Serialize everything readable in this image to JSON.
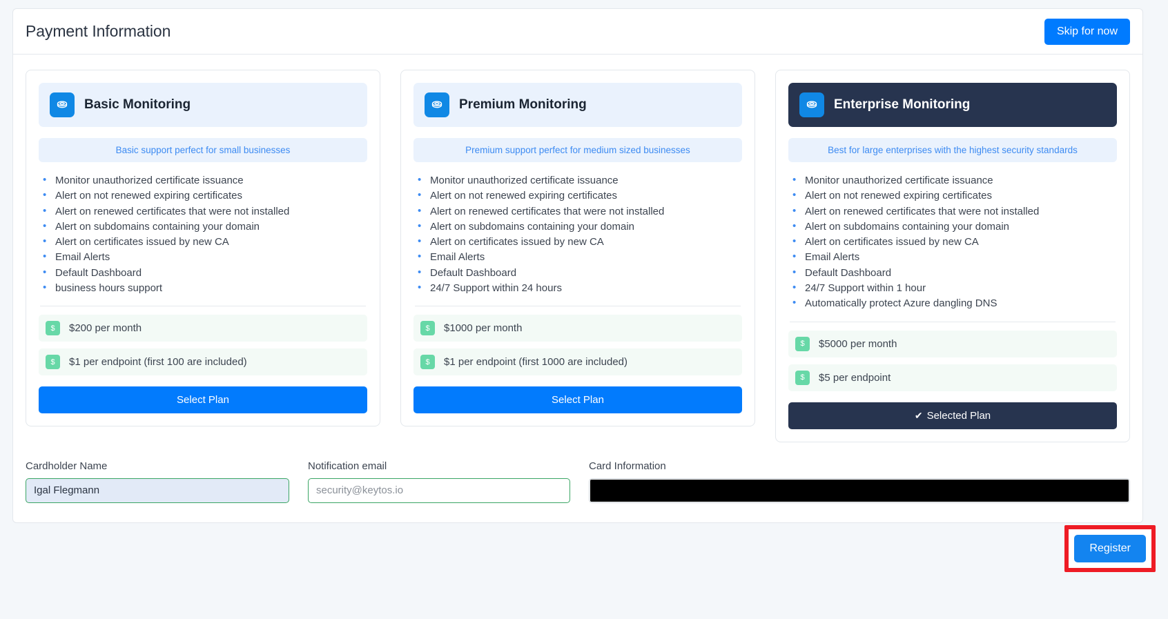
{
  "header": {
    "title": "Payment Information",
    "skip_label": "Skip for now"
  },
  "icons": {
    "plan": "layered-disc-icon",
    "price": "dollar-badge-icon",
    "check": "check-icon"
  },
  "plans": [
    {
      "name": "Basic Monitoring",
      "tagline": "Basic support perfect for small businesses",
      "features": [
        "Monitor unauthorized certificate issuance",
        "Alert on not renewed expiring certificates",
        "Alert on renewed certificates that were not installed",
        "Alert on subdomains containing your domain",
        "Alert on certificates issued by new CA",
        "Email Alerts",
        "Default Dashboard",
        "business hours support"
      ],
      "prices": [
        {
          "badge": "$",
          "text": "$200 per month"
        },
        {
          "badge": "$",
          "text": "$1 per endpoint (first 100 are included)"
        }
      ],
      "button_label": "Select Plan",
      "selected": false
    },
    {
      "name": "Premium Monitoring",
      "tagline": "Premium support perfect for medium sized businesses",
      "features": [
        "Monitor unauthorized certificate issuance",
        "Alert on not renewed expiring certificates",
        "Alert on renewed certificates that were not installed",
        "Alert on subdomains containing your domain",
        "Alert on certificates issued by new CA",
        "Email Alerts",
        "Default Dashboard",
        "24/7 Support within 24 hours"
      ],
      "prices": [
        {
          "badge": "$",
          "text": "$1000 per month"
        },
        {
          "badge": "$",
          "text": "$1 per endpoint (first 1000 are included)"
        }
      ],
      "button_label": "Select Plan",
      "selected": false
    },
    {
      "name": "Enterprise Monitoring",
      "tagline": "Best for large enterprises with the highest security standards",
      "features": [
        "Monitor unauthorized certificate issuance",
        "Alert on not renewed expiring certificates",
        "Alert on renewed certificates that were not installed",
        "Alert on subdomains containing your domain",
        "Alert on certificates issued by new CA",
        "Email Alerts",
        "Default Dashboard",
        "24/7 Support within 1 hour",
        "Automatically protect Azure dangling DNS"
      ],
      "prices": [
        {
          "badge": "$",
          "text": "$5000 per month"
        },
        {
          "badge": "$",
          "text": "$5 per endpoint"
        }
      ],
      "button_label": "Selected Plan",
      "button_check": "✔",
      "selected": true
    }
  ],
  "form": {
    "cardholder": {
      "label": "Cardholder Name",
      "value": "Igal Flegmann",
      "placeholder": ""
    },
    "email": {
      "label": "Notification email",
      "value": "",
      "placeholder": "security@keytos.io"
    },
    "card": {
      "label": "Card Information",
      "value": ""
    }
  },
  "footer": {
    "register_label": "Register"
  },
  "colors": {
    "accent_blue": "#007bff",
    "dark_navy": "#27344f",
    "green_badge": "#67d8a7",
    "field_border_green": "#3aa564",
    "highlight_red": "#ee1c25"
  }
}
